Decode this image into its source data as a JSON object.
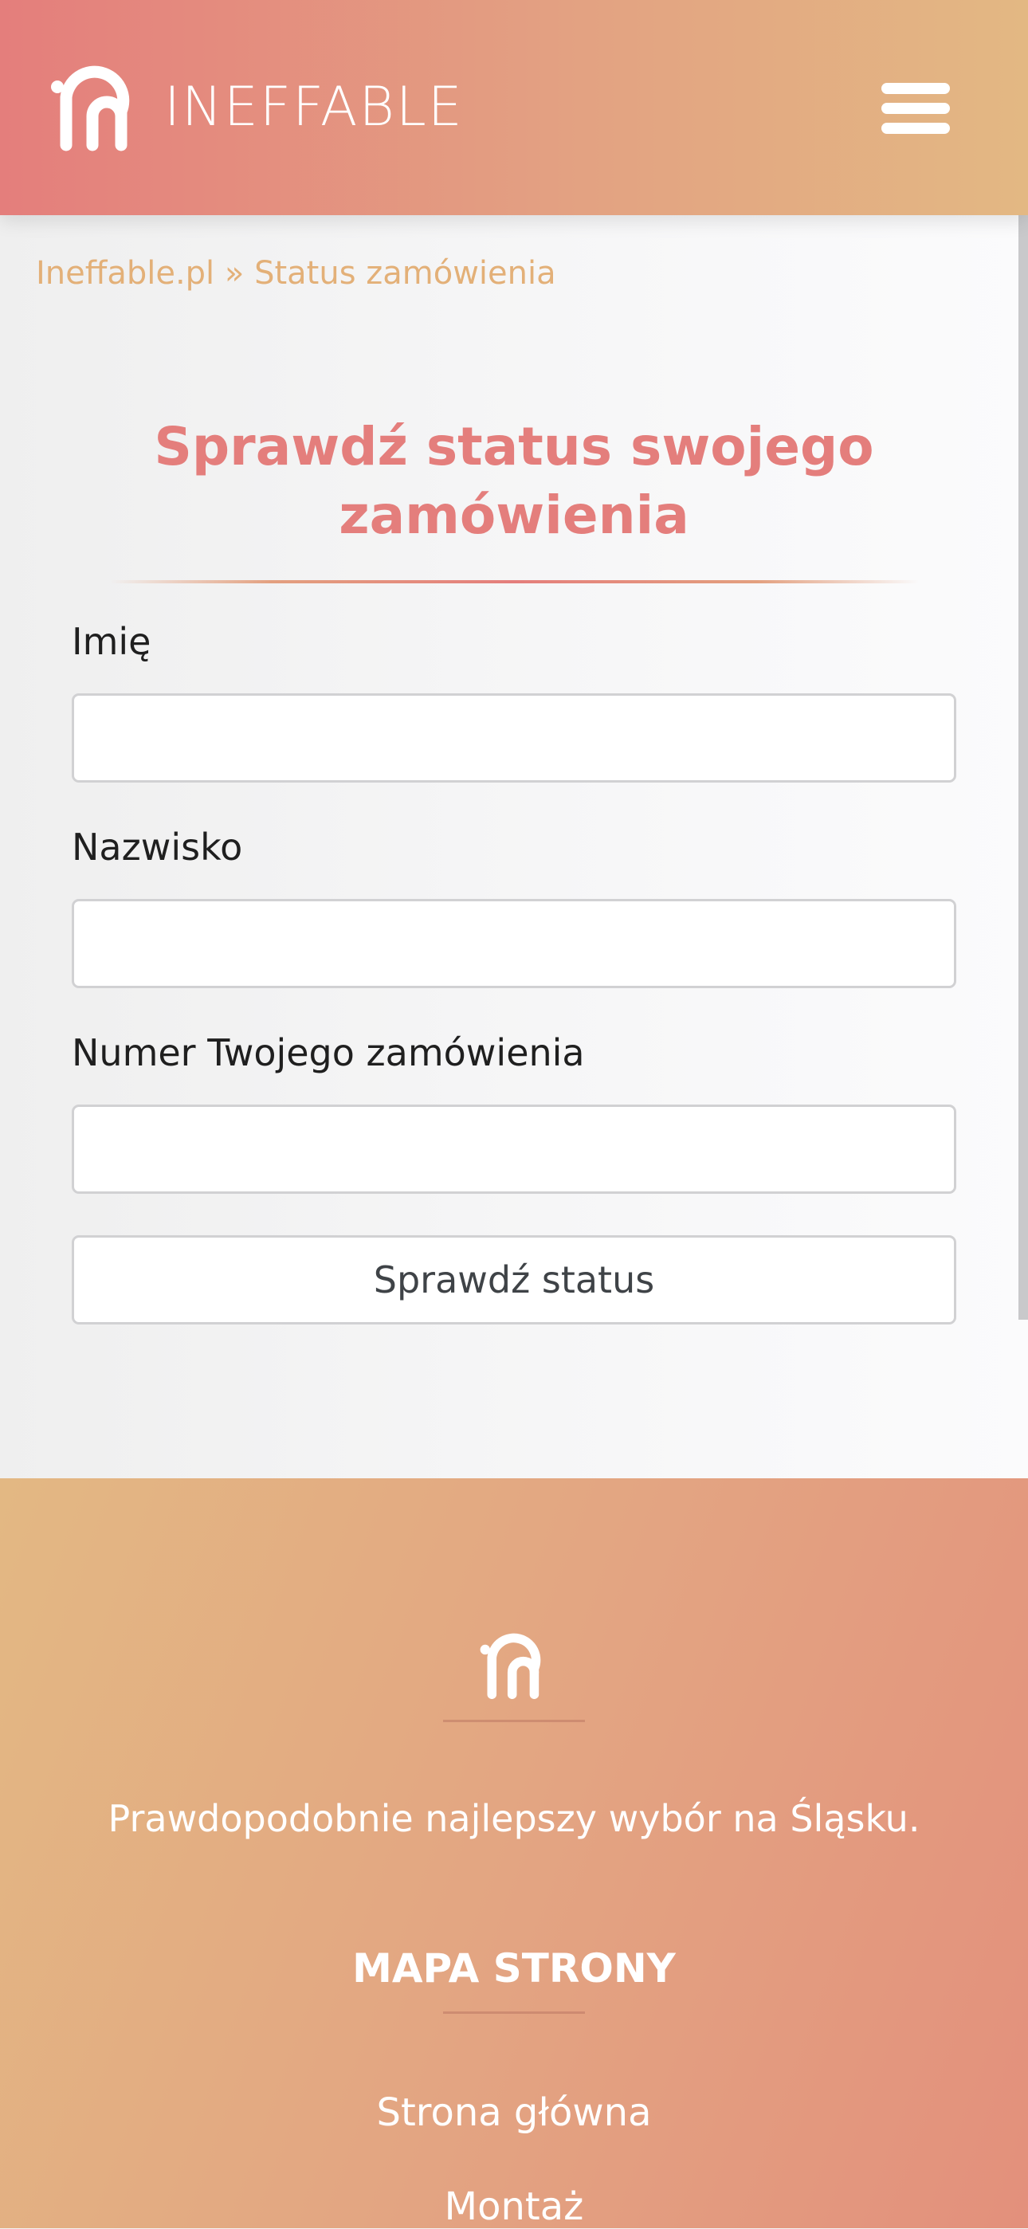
{
  "header": {
    "brand_name": "INEFFABLE",
    "logo_icon": "ineffable-in-logo",
    "menu_icon": "hamburger-menu-icon"
  },
  "breadcrumb": {
    "home_label": "Ineffable.pl",
    "separator": " » ",
    "current_label": "Status zamówienia"
  },
  "page": {
    "title": "Sprawdź status swojego zamówienia"
  },
  "form": {
    "first_name_label": "Imię",
    "first_name_value": "",
    "last_name_label": "Nazwisko",
    "last_name_value": "",
    "order_number_label": "Numer Twojego zamówienia",
    "order_number_value": "",
    "submit_label": "Sprawdź status"
  },
  "footer": {
    "tagline": "Prawdopodobnie najlepszy wybór na Śląsku.",
    "sitemap_heading": "MAPA STRONY",
    "links": [
      "Strona główna",
      "Montaż"
    ]
  },
  "colors": {
    "brand_coral": "#e47e7c",
    "brand_gold": "#e3b883",
    "breadcrumb": "#e3b078",
    "text_dark": "#1f1f1f"
  }
}
